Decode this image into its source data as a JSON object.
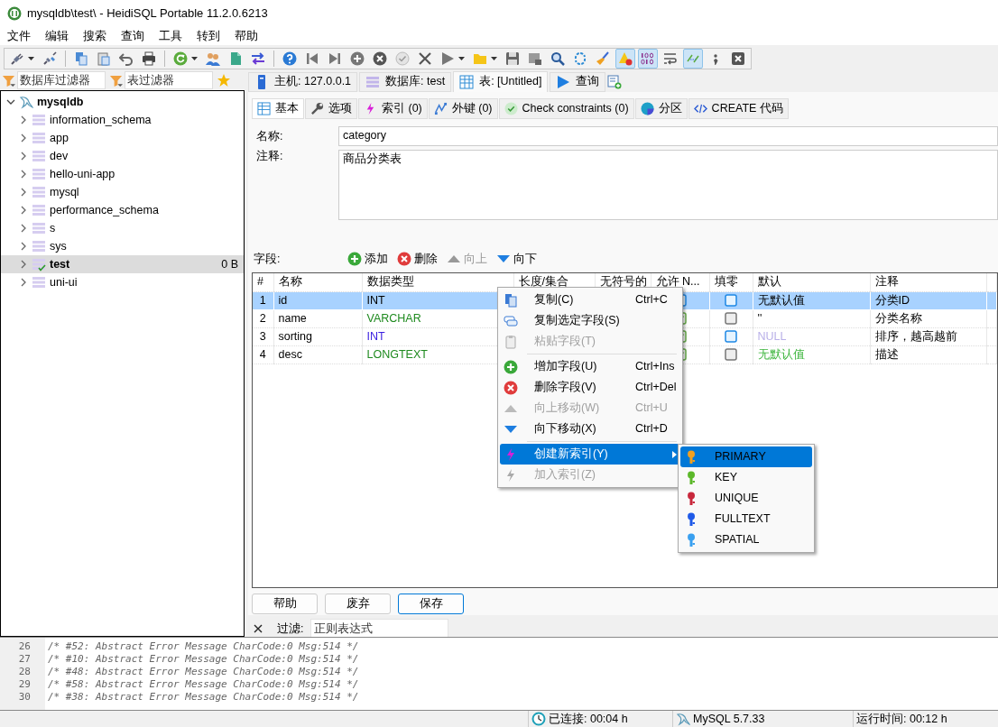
{
  "window": {
    "title": "mysqldb\\test\\ - HeidiSQL Portable 11.2.0.6213"
  },
  "menu_bar": [
    "文件",
    "编辑",
    "搜索",
    "查询",
    "工具",
    "转到",
    "帮助"
  ],
  "toolbar": [
    [
      {
        "pressed": false,
        "dropdown": true
      },
      {
        "pressed": false,
        "dropdown": false
      }
    ],
    [
      {
        "pressed": false,
        "dropdown": false
      },
      {
        "pressed": false,
        "dropdown": false
      },
      {
        "pressed": false,
        "dropdown": false
      },
      {
        "pressed": false,
        "dropdown": false
      }
    ],
    [
      {
        "pressed": false,
        "dropdown": true
      },
      {
        "pressed": false,
        "dropdown": false
      },
      {
        "pressed": false,
        "dropdown": false
      },
      {
        "pressed": false,
        "dropdown": false
      }
    ],
    [
      {
        "pressed": false,
        "dropdown": false
      },
      {
        "pressed": false,
        "dropdown": false
      },
      {
        "pressed": false,
        "dropdown": false
      },
      {
        "pressed": false,
        "dropdown": false
      },
      {
        "pressed": false,
        "dropdown": false
      },
      {
        "pressed": false,
        "dropdown": false
      },
      {
        "pressed": false,
        "dropdown": false
      },
      {
        "pressed": false,
        "dropdown": true
      },
      {
        "pressed": false,
        "dropdown": true
      },
      {
        "pressed": false,
        "dropdown": false
      },
      {
        "pressed": false,
        "dropdown": false
      },
      {
        "pressed": false,
        "dropdown": false
      },
      {
        "pressed": false,
        "dropdown": false
      },
      {
        "pressed": false,
        "dropdown": false
      },
      {
        "pressed": true,
        "dropdown": false
      },
      {
        "pressed": true,
        "dropdown": false
      },
      {
        "pressed": false,
        "dropdown": false
      },
      {
        "pressed": true,
        "dropdown": false
      },
      {
        "pressed": false,
        "dropdown": false
      },
      {
        "pressed": false,
        "dropdown": false
      }
    ]
  ],
  "database_filter": {
    "placeholder": "数据库过滤器"
  },
  "table_filter": {
    "placeholder": "表过滤器"
  },
  "tree": [
    {
      "label": "mysqldb",
      "expanded": true,
      "children": [
        {
          "label": "information_schema",
          "expanded": false,
          "selected": false,
          "current": false
        },
        {
          "label": "app",
          "expanded": false,
          "selected": false,
          "current": false
        },
        {
          "label": "dev",
          "expanded": false,
          "selected": false,
          "current": false
        },
        {
          "label": "hello-uni-app",
          "expanded": false,
          "selected": false,
          "current": false
        },
        {
          "label": "mysql",
          "expanded": false,
          "selected": false,
          "current": false
        },
        {
          "label": "performance_schema",
          "expanded": false,
          "selected": false,
          "current": false
        },
        {
          "label": "s",
          "expanded": false,
          "selected": false,
          "current": false
        },
        {
          "label": "sys",
          "expanded": false,
          "selected": false,
          "current": false
        },
        {
          "label": "test",
          "size": "0 B",
          "expanded": false,
          "selected": true,
          "current": true
        },
        {
          "label": "uni-ui",
          "expanded": false,
          "selected": false,
          "current": false
        }
      ]
    }
  ],
  "main_tabs": [
    {
      "label": "主机: 127.0.0.1",
      "selected": false
    },
    {
      "label": "数据库: test",
      "selected": false
    },
    {
      "label": "表: [Untitled]",
      "selected": true
    },
    {
      "label": "查询",
      "selected": false
    }
  ],
  "sub_tabs": [
    {
      "label": "基本",
      "selected": true
    },
    {
      "label": "选项",
      "selected": false
    },
    {
      "label": "索引 (0)",
      "selected": false
    },
    {
      "label": "外键 (0)",
      "selected": false
    },
    {
      "label": "Check constraints (0)",
      "selected": false
    },
    {
      "label": "分区",
      "selected": false
    },
    {
      "label": "CREATE 代码",
      "selected": false
    }
  ],
  "form": {
    "name_label": "名称:",
    "name_value": "category",
    "comment_label": "注释:",
    "comment_value": "商品分类表"
  },
  "fields_toolbar": {
    "label": "字段:",
    "buttons": [
      {
        "label": "添加",
        "disabled": false
      },
      {
        "label": "删除",
        "disabled": false
      },
      {
        "label": "向上",
        "disabled": true
      },
      {
        "label": "向下",
        "disabled": false
      }
    ]
  },
  "columns": [
    "#",
    "名称",
    "数据类型",
    "长度/集合",
    "无符号的",
    "允许 N...",
    "填零",
    "默认",
    "注释"
  ],
  "rows": [
    {
      "number": "1",
      "name": "id",
      "type": {
        "text": "INT"
      },
      "allow_null": false,
      "zerofill": false,
      "zerofill_applicable": true,
      "default": {
        "text": "无默认值"
      },
      "comment": "分类ID",
      "selected": true
    },
    {
      "number": "2",
      "name": "name",
      "type": {
        "text": "VARCHAR",
        "color": "#1f8a1f"
      },
      "allow_null": true,
      "zerofill": false,
      "zerofill_applicable": false,
      "default": {
        "text": "''"
      },
      "comment": "分类名称",
      "selected": false
    },
    {
      "number": "3",
      "name": "sorting",
      "type": {
        "text": "INT",
        "color": "#3a1fe0"
      },
      "allow_null": true,
      "zerofill": false,
      "zerofill_applicable": true,
      "default": {
        "text": "NULL",
        "color": "#b9b0e8"
      },
      "comment": "排序，越高越前",
      "selected": false
    },
    {
      "number": "4",
      "name": "desc",
      "type": {
        "text": "LONGTEXT",
        "color": "#1f8a1f"
      },
      "allow_null": true,
      "zerofill": false,
      "zerofill_applicable": false,
      "default": {
        "text": "无默认值",
        "color": "#3cb53c"
      },
      "comment": "描述",
      "selected": false
    }
  ],
  "context_menu": [
    {
      "kind": "item",
      "label": "复制(C)",
      "shortcut": "Ctrl+C",
      "disabled": false,
      "highlighted": false
    },
    {
      "kind": "item",
      "label": "复制选定字段(S)",
      "disabled": false,
      "highlighted": false
    },
    {
      "kind": "item",
      "label": "粘贴字段(T)",
      "disabled": true,
      "highlighted": false
    },
    {
      "kind": "separator"
    },
    {
      "kind": "item",
      "label": "增加字段(U)",
      "shortcut": "Ctrl+Ins",
      "disabled": false,
      "highlighted": false
    },
    {
      "kind": "item",
      "label": "删除字段(V)",
      "shortcut": "Ctrl+Del",
      "disabled": false,
      "highlighted": false
    },
    {
      "kind": "item",
      "label": "向上移动(W)",
      "shortcut": "Ctrl+U",
      "disabled": true,
      "highlighted": false
    },
    {
      "kind": "item",
      "label": "向下移动(X)",
      "shortcut": "Ctrl+D",
      "disabled": false,
      "highlighted": false
    },
    {
      "kind": "separator"
    },
    {
      "kind": "submenu",
      "label": "创建新索引(Y)",
      "disabled": false,
      "highlighted": true
    },
    {
      "kind": "item",
      "label": "加入索引(Z)",
      "disabled": true,
      "highlighted": false
    }
  ],
  "submenu": [
    {
      "label": "PRIMARY",
      "color": "#f0a020",
      "selected": true
    },
    {
      "label": "KEY",
      "color": "#5cb82a",
      "selected": false
    },
    {
      "label": "UNIQUE",
      "color": "#c8283c",
      "selected": false
    },
    {
      "label": "FULLTEXT",
      "color": "#1f5ae8",
      "selected": false
    },
    {
      "label": "SPATIAL",
      "color": "#3aa0f0",
      "selected": false
    }
  ],
  "buttons": [
    {
      "label": "帮助",
      "default": false
    },
    {
      "label": "废弃",
      "default": false
    },
    {
      "label": "保存",
      "default": true
    }
  ],
  "filter": {
    "label": "过滤:",
    "placeholder": "正则表达式"
  },
  "log": [
    {
      "line": "26",
      "text": "/* #52: Abstract Error Message CharCode:0 Msg:514 */"
    },
    {
      "line": "27",
      "text": "/* #10: Abstract Error Message CharCode:0 Msg:514 */"
    },
    {
      "line": "28",
      "text": "/* #48: Abstract Error Message CharCode:0 Msg:514 */"
    },
    {
      "line": "29",
      "text": "/* #58: Abstract Error Message CharCode:0 Msg:514 */"
    },
    {
      "line": "30",
      "text": "/* #38: Abstract Error Message CharCode:0 Msg:514 */"
    }
  ],
  "status_bar": [
    {
      "text": "已连接: 00:04 h"
    },
    {
      "text": "MySQL 5.7.33"
    },
    {
      "text": "运行时间: 00:12 h"
    }
  ]
}
